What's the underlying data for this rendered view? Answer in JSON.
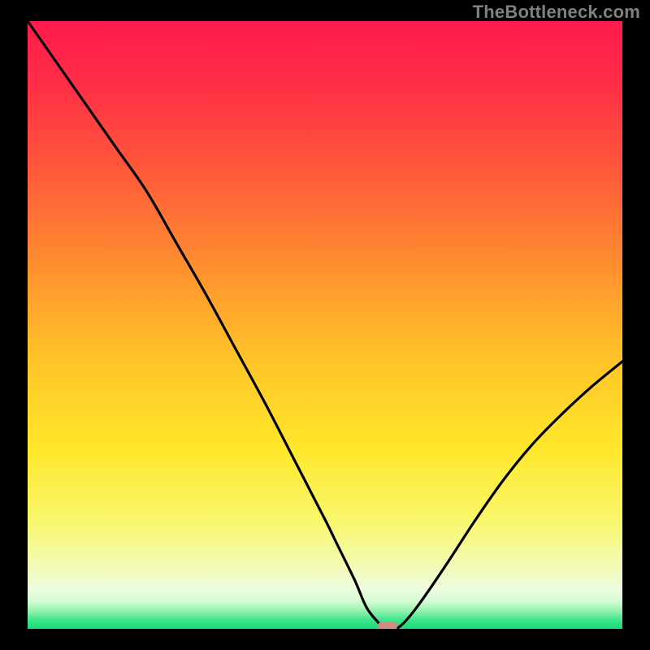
{
  "watermark": "TheBottleneck.com",
  "chart_data": {
    "type": "line",
    "title": "",
    "xlabel": "",
    "ylabel": "",
    "xlim": [
      0,
      100
    ],
    "ylim": [
      0,
      100
    ],
    "x": [
      0,
      5,
      10,
      15,
      20,
      25,
      30,
      35,
      40,
      45,
      50,
      52,
      55,
      57,
      59,
      60,
      62,
      65,
      70,
      75,
      80,
      85,
      90,
      95,
      100
    ],
    "values": [
      100,
      93,
      86,
      79,
      72,
      63.5,
      55,
      46,
      37,
      27.5,
      18,
      14,
      8,
      3.5,
      1,
      0,
      0,
      3,
      10,
      17.5,
      24.5,
      30.5,
      35.5,
      40,
      44
    ],
    "minimum_marker": {
      "x": 60.5,
      "y": 0
    },
    "gradient_stops": [
      {
        "offset": 0.0,
        "color": "#ff1a4d"
      },
      {
        "offset": 0.1,
        "color": "#ff2d46"
      },
      {
        "offset": 0.25,
        "color": "#ff5a3a"
      },
      {
        "offset": 0.4,
        "color": "#ff8e2f"
      },
      {
        "offset": 0.55,
        "color": "#ffc228"
      },
      {
        "offset": 0.7,
        "color": "#ffe62a"
      },
      {
        "offset": 0.82,
        "color": "#f9f76a"
      },
      {
        "offset": 0.9,
        "color": "#f2fbb8"
      },
      {
        "offset": 0.935,
        "color": "#ecfde0"
      },
      {
        "offset": 0.955,
        "color": "#d3fbd2"
      },
      {
        "offset": 0.97,
        "color": "#96f3b0"
      },
      {
        "offset": 0.985,
        "color": "#3fe68e"
      },
      {
        "offset": 1.0,
        "color": "#16d977"
      }
    ]
  }
}
